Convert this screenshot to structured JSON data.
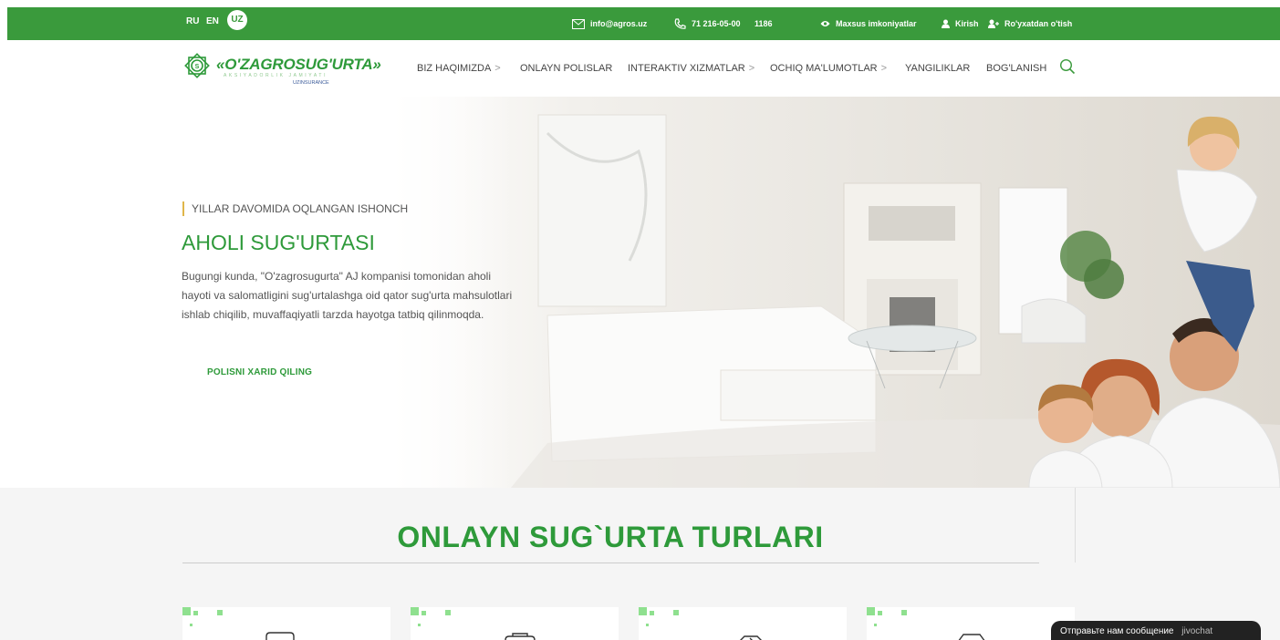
{
  "topbar": {
    "lang_ru": "RU",
    "lang_en": "EN",
    "lang_uz": "UZ",
    "email": "info@agros.uz",
    "phone": "71 216-05-00",
    "short_number": "1186",
    "accessibility": "Maxsus imkoniyatlar",
    "login": "Kirish",
    "register": "Ro'yxatdan o'tish"
  },
  "logo": {
    "title": "«O'ZAGROSUG'URTA»",
    "subtitle": "AKSIYADORLIK JAMIYATI",
    "brand": "UZINSURANCE"
  },
  "nav": {
    "items": [
      {
        "label": "BIZ HAQIMIZDA",
        "has_submenu": true
      },
      {
        "label": "ONLAYN POLISLAR",
        "has_submenu": false
      },
      {
        "label": "INTERAKTIV XIZMATLAR",
        "has_submenu": true
      },
      {
        "label": "OCHIQ MA'LUMOTLAR",
        "has_submenu": true
      },
      {
        "label": "YANGILIKLAR",
        "has_submenu": false
      },
      {
        "label": "BOG'LANISH",
        "has_submenu": false
      }
    ],
    "chevron": ">"
  },
  "hero": {
    "tagline": "YILLAR DAVOMIDA OQLANGAN ISHONCH",
    "title": "AHOLI SUG'URTASI",
    "text": "Bugungi kunda, \"O'zagrosugurta\" AJ kompanisi tomonidan aholi hayoti va salomatligini sug'urtalashga oid qator sug'urta mahsulotlari ishlab chiqilib, muvaffaqiyatli tarzda hayotga tatbiq qilinmoqda.",
    "cta": "POLISNI XARID QILING"
  },
  "section": {
    "title": "ONLAYN SUG`URTA TURLARI"
  },
  "chat": {
    "label": "Отправьте нам сообщение",
    "brand": "jivochat"
  },
  "colors": {
    "brand_green": "#2e9a3a",
    "topbar_green": "#3a9a3c",
    "accent_gold": "#e0b64a"
  }
}
